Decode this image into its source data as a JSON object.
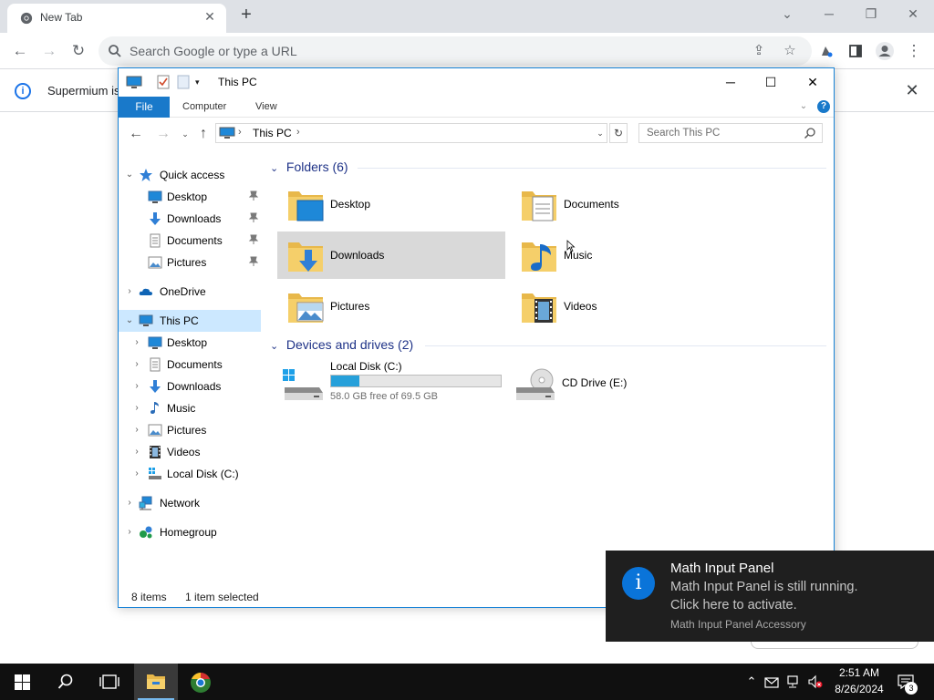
{
  "browser": {
    "tab_title": "New Tab",
    "tab_close": "✕",
    "new_tab": "+",
    "omnibox_placeholder": "Search Google or type a URL",
    "infobar_text": "Supermium is"
  },
  "explorer": {
    "title": "This PC",
    "ribbon_tabs": {
      "file": "File",
      "computer": "Computer",
      "view": "View"
    },
    "address": {
      "location": "This PC"
    },
    "search_placeholder": "Search This PC",
    "nav": {
      "quick_access": "Quick access",
      "qa_items": [
        "Desktop",
        "Downloads",
        "Documents",
        "Pictures"
      ],
      "onedrive": "OneDrive",
      "this_pc": "This PC",
      "pc_items": [
        "Desktop",
        "Documents",
        "Downloads",
        "Music",
        "Pictures",
        "Videos",
        "Local Disk (C:)"
      ],
      "network": "Network",
      "homegroup": "Homegroup"
    },
    "folders_header": "Folders (6)",
    "folders": [
      "Desktop",
      "Documents",
      "Downloads",
      "Music",
      "Pictures",
      "Videos"
    ],
    "devices_header": "Devices and drives (2)",
    "drives": {
      "local_disk": {
        "label": "Local Disk (C:)",
        "free_text": "58.0 GB free of 69.5 GB",
        "used_fraction": 0.165
      },
      "cd_drive": {
        "label": "CD Drive (E:)"
      }
    },
    "status": {
      "items": "8 items",
      "selected": "1 item selected"
    }
  },
  "toast": {
    "title": "Math Input Panel",
    "line1": "Math Input Panel is still running.",
    "line2": "Click here to activate.",
    "source": "Math Input Panel Accessory"
  },
  "taskbar": {
    "time": "2:51 AM",
    "date": "8/26/2024",
    "notification_count": "3"
  },
  "colors": {
    "accent": "#1979ca",
    "selection": "#cce8ff",
    "drive_bar": "#26a0da",
    "toast_bg": "#1f1f1f",
    "taskbar_bg": "#101010"
  }
}
